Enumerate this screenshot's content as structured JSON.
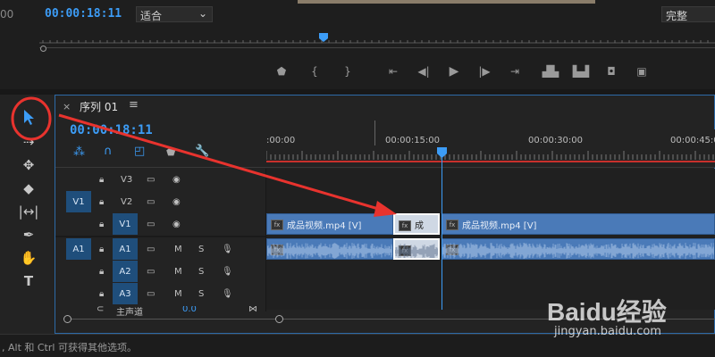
{
  "monitor": {
    "timecode": "00:00:18:11",
    "fit_value": "适合",
    "quality_value": "完整",
    "left_edge_timecode": "00"
  },
  "timeline": {
    "tab_label": "序列 01",
    "timecode": "00:00:18:11",
    "ruler_labels": [
      ":00:00",
      "00:00:15:00",
      "00:00:30:00",
      "00:00:45:0"
    ],
    "tracks": {
      "v3": "V3",
      "v2": "V2",
      "v1": "V1",
      "a1": "A1",
      "a2": "A2",
      "a3": "A3",
      "v1_target": "V1",
      "a1_target": "A1",
      "mute": "M",
      "solo": "S",
      "master": "主声道",
      "master_value": "0.0"
    },
    "clips": {
      "v1_left": "成品视频.mp4 [V]",
      "v1_middle": "成",
      "v1_right": "成品视频.mp4 [V]"
    }
  },
  "status_bar": {
    "text": ", Alt 和 Ctrl 可获得其他选项。"
  },
  "watermark": {
    "logo_text": "Baidu经验",
    "url": "jingyan.baidu.com"
  },
  "colors": {
    "accent": "#3c9cf6",
    "annotation_red": "#e8332e",
    "clip_blue": "#4a7ab8",
    "track_target": "#1f4e7b"
  }
}
